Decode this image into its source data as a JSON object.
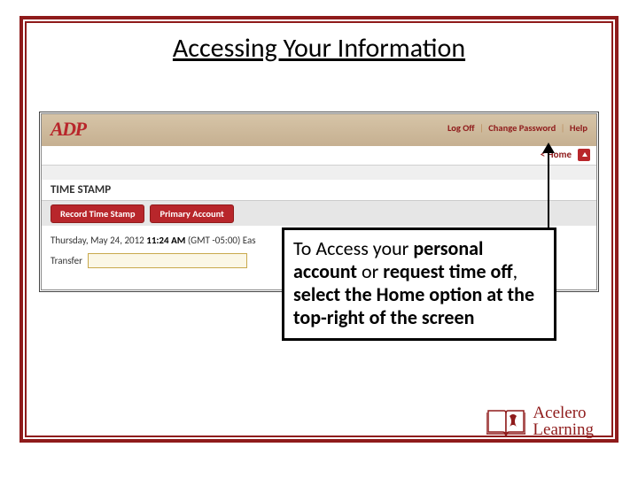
{
  "slide": {
    "title": "Accessing Your Information"
  },
  "adp": {
    "logo_text": "ADP",
    "top_links": {
      "logoff": "Log Off",
      "change_password": "Change Password",
      "help": "Help"
    },
    "home_link": "< Home",
    "section_title": "TIME STAMP",
    "buttons": {
      "record": "Record Time Stamp",
      "primary": "Primary Account"
    },
    "time_line": {
      "date": "Thursday, May 24, 2012 ",
      "time": "11:24 AM",
      "zone_prefix": " (GMT -05:00) Eas"
    },
    "transfer_label": "Transfer"
  },
  "callout": {
    "text_prefix": "To Access your ",
    "bold_1": "personal account",
    "mid_1": " or ",
    "bold_2": "request time off",
    "mid_2": ", ",
    "bold_3": "select the Home option at the top-right of the screen"
  },
  "brand": {
    "l1": "Acelero",
    "l2": "Learning"
  }
}
